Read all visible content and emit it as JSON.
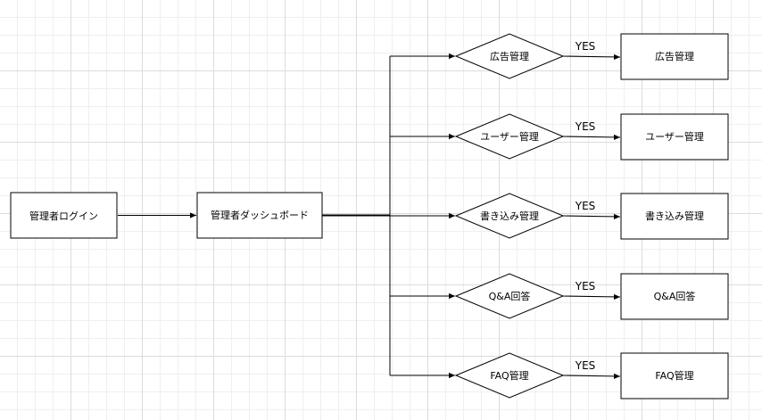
{
  "nodes": {
    "login": "管理者ログイン",
    "dashboard": "管理者ダッシュボード"
  },
  "branches": [
    {
      "decision": "広告管理",
      "edge_label": "YES",
      "result": "広告管理"
    },
    {
      "decision": "ユーザー管理",
      "edge_label": "YES",
      "result": "ユーザー管理"
    },
    {
      "decision": "書き込み管理",
      "edge_label": "YES",
      "result": "書き込み管理"
    },
    {
      "decision": "Q&A回答",
      "edge_label": "YES",
      "result": "Q&A回答"
    },
    {
      "decision": "FAQ管理",
      "edge_label": "YES",
      "result": "FAQ管理"
    }
  ],
  "colors": {
    "stroke": "#000000",
    "fill": "#ffffff"
  }
}
